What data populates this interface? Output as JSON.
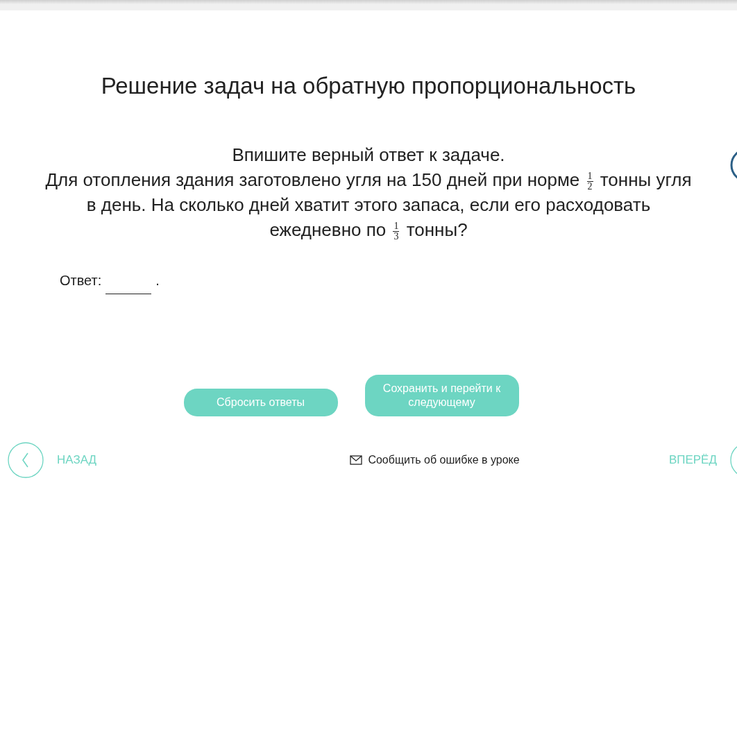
{
  "title": "Решение задач на обратную пропорциональность",
  "instruction": "Впишите верный ответ к задаче.",
  "question": [
    {
      "kind": "text",
      "text": "Для отопления здания заготовлено угля на 150 дней при норме "
    },
    {
      "kind": "fraction",
      "numerator": "1",
      "denominator": "2"
    },
    {
      "kind": "text",
      "text": " тонны угля в день. На сколько дней хватит этого запаса, если его расходовать ежедневно по "
    },
    {
      "kind": "fraction",
      "numerator": "1",
      "denominator": "3"
    },
    {
      "kind": "text",
      "text": " тонны?"
    }
  ],
  "answer": {
    "label": "Ответ:",
    "suffix": "."
  },
  "buttons": [
    {
      "label": "Сбросить ответы"
    },
    {
      "label": "Сохранить и перейти к следующему"
    }
  ],
  "nav": {
    "back": "НАЗАД",
    "report": "Сообщить об ошибке в уроке",
    "forward": "ВПЕРЁД"
  }
}
